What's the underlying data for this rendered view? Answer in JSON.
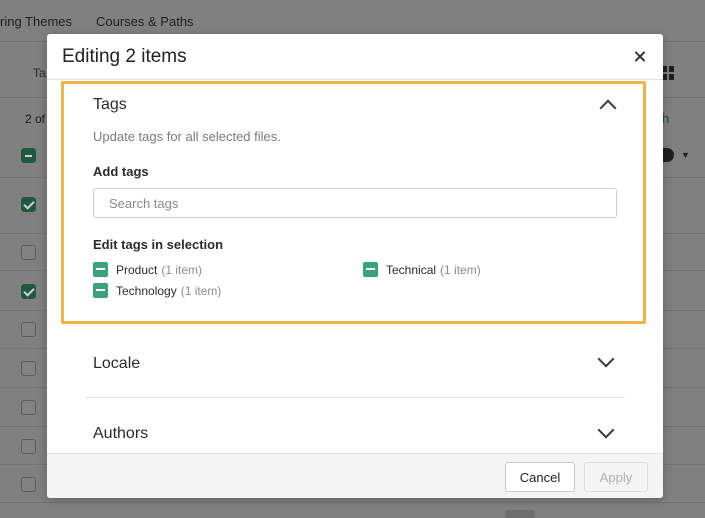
{
  "background": {
    "nav_tabs": [
      "ring Themes",
      "Courses & Paths"
    ],
    "tab_fragment": "Ta",
    "count_fragment": "2 of",
    "link_fragment": "h"
  },
  "modal": {
    "title": "Editing 2 items",
    "close_label": "Close"
  },
  "tags_section": {
    "title": "Tags",
    "description": "Update tags for all selected files.",
    "add_tags_label": "Add tags",
    "search_placeholder": "Search tags",
    "search_value": "",
    "edit_label": "Edit tags in selection",
    "tags": [
      {
        "name": "Product",
        "count": "(1 item)",
        "state": "partial"
      },
      {
        "name": "Technical",
        "count": "(1 item)",
        "state": "partial"
      },
      {
        "name": "Technology",
        "count": "(1 item)",
        "state": "partial"
      }
    ]
  },
  "sections": {
    "locale": "Locale",
    "authors": "Authors"
  },
  "footer": {
    "cancel_label": "Cancel",
    "apply_label": "Apply"
  },
  "colors": {
    "highlight": "#f1b24a",
    "checkbox_green": "#3aa37a",
    "bg_checkbox_green": "#1f5a40"
  },
  "icons": {
    "close": "close-icon",
    "expand": "chevron-down-icon",
    "collapse": "chevron-up-icon",
    "partial_checkbox": "minus-checkbox-icon"
  }
}
